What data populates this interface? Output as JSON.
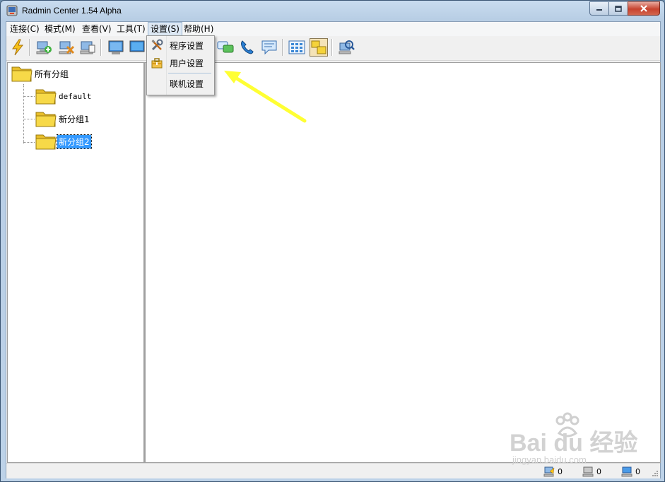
{
  "window": {
    "title": "Radmin Center 1.54 Alpha"
  },
  "menubar": {
    "items": [
      {
        "label": "连接(C)"
      },
      {
        "label": "模式(M)"
      },
      {
        "label": "查看(V)"
      },
      {
        "label": "工具(T)"
      },
      {
        "label": "设置(S)"
      },
      {
        "label": "帮助(H)"
      }
    ]
  },
  "settings_menu": {
    "items": [
      {
        "label": "程序设置",
        "icon": "tools-icon"
      },
      {
        "label": "用户设置",
        "icon": "user-toolbox-icon"
      },
      {
        "label": "联机设置",
        "icon": ""
      }
    ]
  },
  "toolbar": {
    "buttons": [
      "connect-lightning-icon",
      "add-computer-icon",
      "delete-computer-icon",
      "computer-properties-icon",
      "full-control-icon",
      "view-only-icon",
      "chat-icon",
      "voice-call-icon",
      "message-icon",
      "large-icons-view-icon",
      "tree-view-icon",
      "scan-network-icon"
    ]
  },
  "tree": {
    "root": "所有分组",
    "children": [
      "default",
      "新分组1",
      "新分组2"
    ],
    "selected": "新分组2"
  },
  "statusbar": {
    "items": [
      {
        "icon": "connected-computers-icon",
        "count": "0"
      },
      {
        "icon": "offline-computers-icon",
        "count": "0"
      },
      {
        "icon": "online-computers-icon",
        "count": "0"
      }
    ]
  },
  "watermark": {
    "text": "Bai du 经验",
    "sub": "jingyan.baidu.com"
  },
  "colors": {
    "selection": "#3399ff",
    "arrow": "#ffff33",
    "folder": "#f5d33a"
  }
}
